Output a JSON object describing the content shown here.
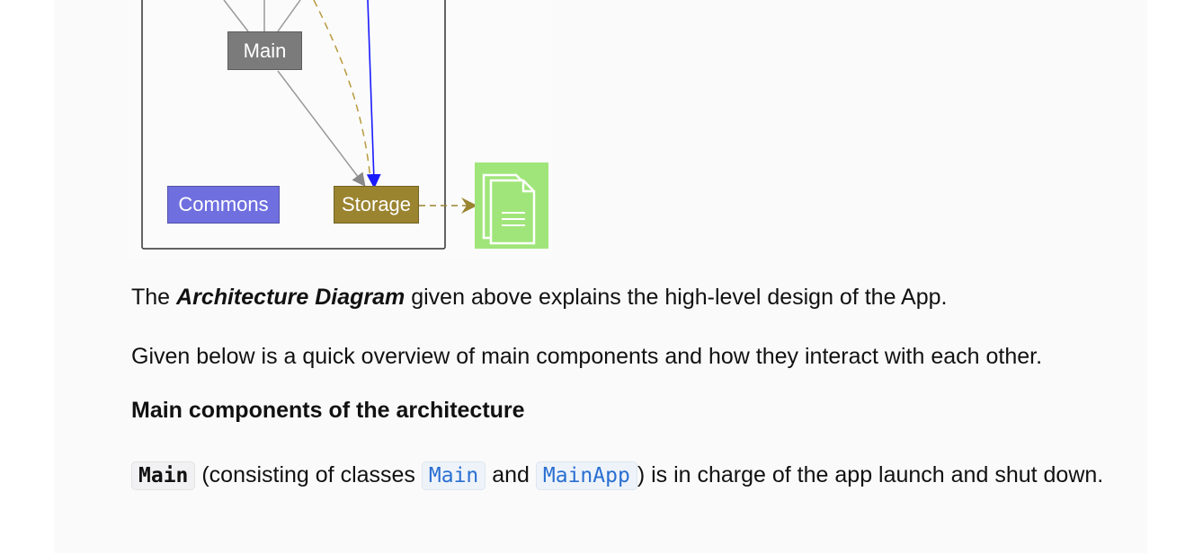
{
  "diagram": {
    "nodes": {
      "main": "Main",
      "commons": "Commons",
      "storage": "Storage"
    },
    "colors": {
      "main": "#7b7b7b",
      "commons": "#6f6fe0",
      "storage": "#9a8430",
      "data_file": "#a0e57a"
    },
    "icons": [
      "document-stack-icon"
    ]
  },
  "content": {
    "p1": {
      "before": "The ",
      "emphasis": "Architecture Diagram",
      "after": " given above explains the high-level design of the App."
    },
    "p2": "Given below is a quick overview of main components and how they interact with each other.",
    "heading": "Main components of the architecture",
    "p3": {
      "code_main": "Main",
      "text1": " (consisting of classes ",
      "code_class1": "Main",
      "text2": " and ",
      "code_class2": "MainApp",
      "text3": ") is in charge of the app launch and shut down."
    }
  }
}
